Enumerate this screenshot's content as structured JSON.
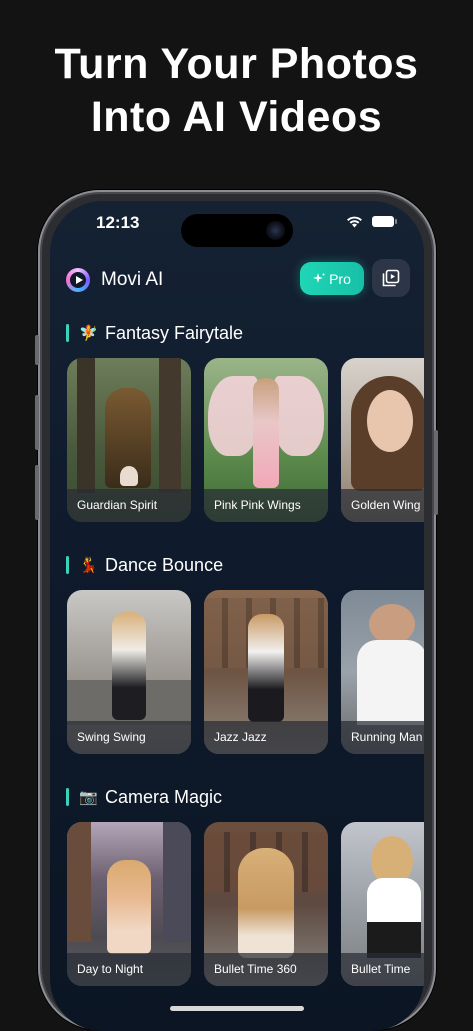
{
  "headline": {
    "line1": "Turn Your Photos",
    "line2": "Into AI Videos"
  },
  "status_bar": {
    "time": "12:13"
  },
  "app": {
    "name": "Movi AI",
    "pro_label": "Pro",
    "pro_icon": "sparkle-icon",
    "library_icon": "video-library-icon"
  },
  "sections": [
    {
      "title": "Fantasy Fairytale",
      "emoji": "🧚",
      "cards": [
        {
          "label": "Guardian Spirit"
        },
        {
          "label": "Pink Pink Wings"
        },
        {
          "label": "Golden Wing"
        }
      ]
    },
    {
      "title": "Dance Bounce",
      "emoji": "💃",
      "cards": [
        {
          "label": "Swing Swing"
        },
        {
          "label": "Jazz Jazz"
        },
        {
          "label": "Running Man"
        }
      ]
    },
    {
      "title": "Camera Magic",
      "emoji": "📷",
      "cards": [
        {
          "label": "Day to Night"
        },
        {
          "label": "Bullet Time 360"
        },
        {
          "label": "Bullet Time"
        }
      ]
    }
  ],
  "colors": {
    "accent": "#1fd6b5",
    "background": "#131313",
    "screen": "#0f1b2c"
  }
}
